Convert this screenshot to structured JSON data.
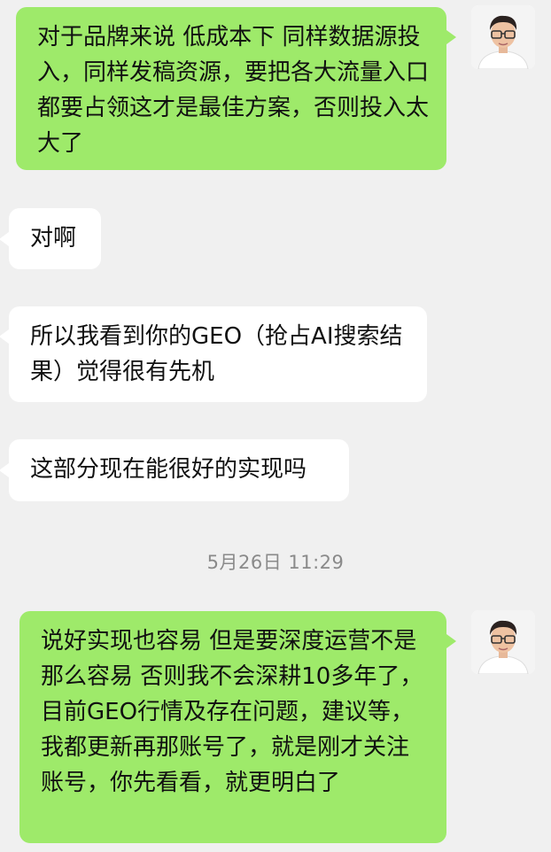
{
  "chat": {
    "messages": [
      {
        "id": "msg1",
        "direction": "sent",
        "text": "对于品牌来说 低成本下 同样数据源投入，同样发稿资源，要把各大流量入口都要占领这才是最佳方案，否则投入太大了"
      },
      {
        "id": "msg2",
        "direction": "received",
        "text": "对啊"
      },
      {
        "id": "msg3",
        "direction": "received",
        "text": "所以我看到你的GEO（抢占AI搜索结果）觉得很有先机"
      },
      {
        "id": "msg4",
        "direction": "received",
        "text": "这部分现在能很好的实现吗"
      },
      {
        "id": "msg5",
        "direction": "sent",
        "text": "说好实现也容易 但是要深度运营不是那么容易 否则我不会深耕10多年了，目前GEO行情及存在问题，建议等，我都更新再那账号了，就是刚才关注账号，你先看看，就更明白了"
      }
    ],
    "timestamp": "5月26日 11:29"
  },
  "colors": {
    "background": "#f0f0f0",
    "sent_bubble": "#9eea6a",
    "received_bubble": "#ffffff",
    "timestamp_text": "#8a8a8a"
  },
  "icons": {
    "self_avatar": "man-with-glasses-avatar"
  }
}
